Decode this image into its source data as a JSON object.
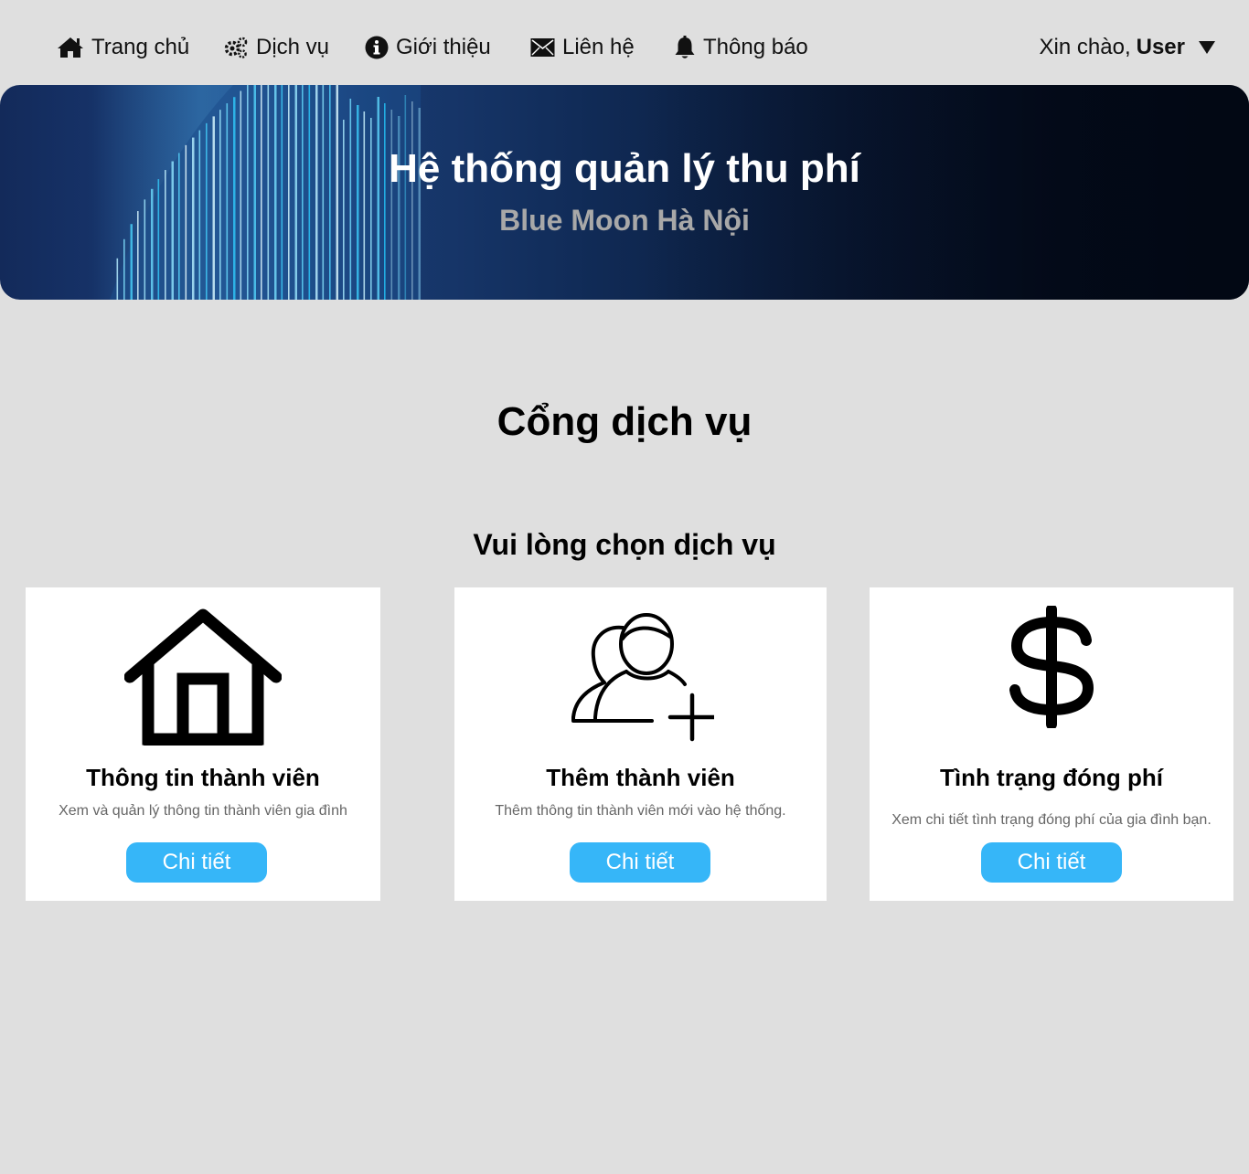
{
  "nav": {
    "items": [
      {
        "label": "Trang chủ",
        "icon": "home-icon"
      },
      {
        "label": "Dịch vụ",
        "icon": "gears-icon"
      },
      {
        "label": "Giới thiệu",
        "icon": "info-icon"
      },
      {
        "label": "Liên hệ",
        "icon": "mail-icon"
      },
      {
        "label": "Thông báo",
        "icon": "bell-icon"
      }
    ],
    "greeting": "Xin chào,",
    "username": "User"
  },
  "banner": {
    "title": "Hệ thống quản lý thu phí",
    "subtitle": "Blue Moon Hà Nội"
  },
  "main": {
    "title": "Cổng dịch vụ",
    "subtitle": "Vui lòng chọn dịch vụ"
  },
  "cards": [
    {
      "title": "Thông tin thành viên",
      "description": "Xem và quản lý thông tin thành viên gia đình",
      "button": "Chi tiết",
      "icon": "house-icon"
    },
    {
      "title": "Thêm thành viên",
      "description": "Thêm thông tin thành viên mới vào hệ thống.",
      "button": "Chi tiết",
      "icon": "add-user-icon"
    },
    {
      "title": "Tình trạng đóng phí",
      "description": "Xem chi tiết tình trạng đóng phí của gia đình bạn.",
      "button": "Chi tiết",
      "icon": "dollar-icon"
    }
  ],
  "colors": {
    "background": "#dfdfdf",
    "accent": "#36b6f8",
    "banner_dark": "#020814",
    "banner_light": "#1a3d7a"
  }
}
